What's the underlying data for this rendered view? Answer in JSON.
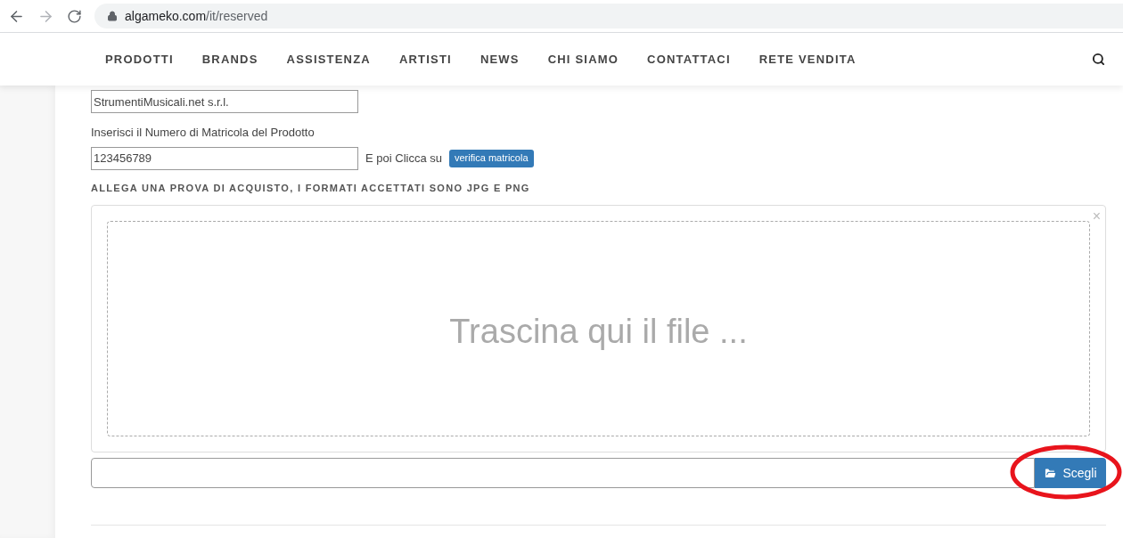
{
  "browser": {
    "url_host": "algameko.com",
    "url_path": "/it/reserved"
  },
  "nav": {
    "items": [
      "PRODOTTI",
      "BRANDS",
      "ASSISTENZA",
      "ARTISTI",
      "NEWS",
      "CHI SIAMO",
      "CONTATTACI",
      "RETE VENDITA"
    ]
  },
  "form": {
    "company_value": "StrumentiMusicali.net s.r.l.",
    "serial_label": "Inserisci il Numero di Matricola del Prodotto",
    "serial_value": "123456789",
    "then_click": "E poi Clicca su",
    "verify_button": "verifica matricola",
    "attach_heading": "ALLEGA UNA PROVA DI ACQUISTO, I FORMATI ACCETTATI SONO JPG E PNG",
    "dropzone_text": "Trascina qui il file ...",
    "close_symbol": "×",
    "choose_button": "Scegli"
  }
}
